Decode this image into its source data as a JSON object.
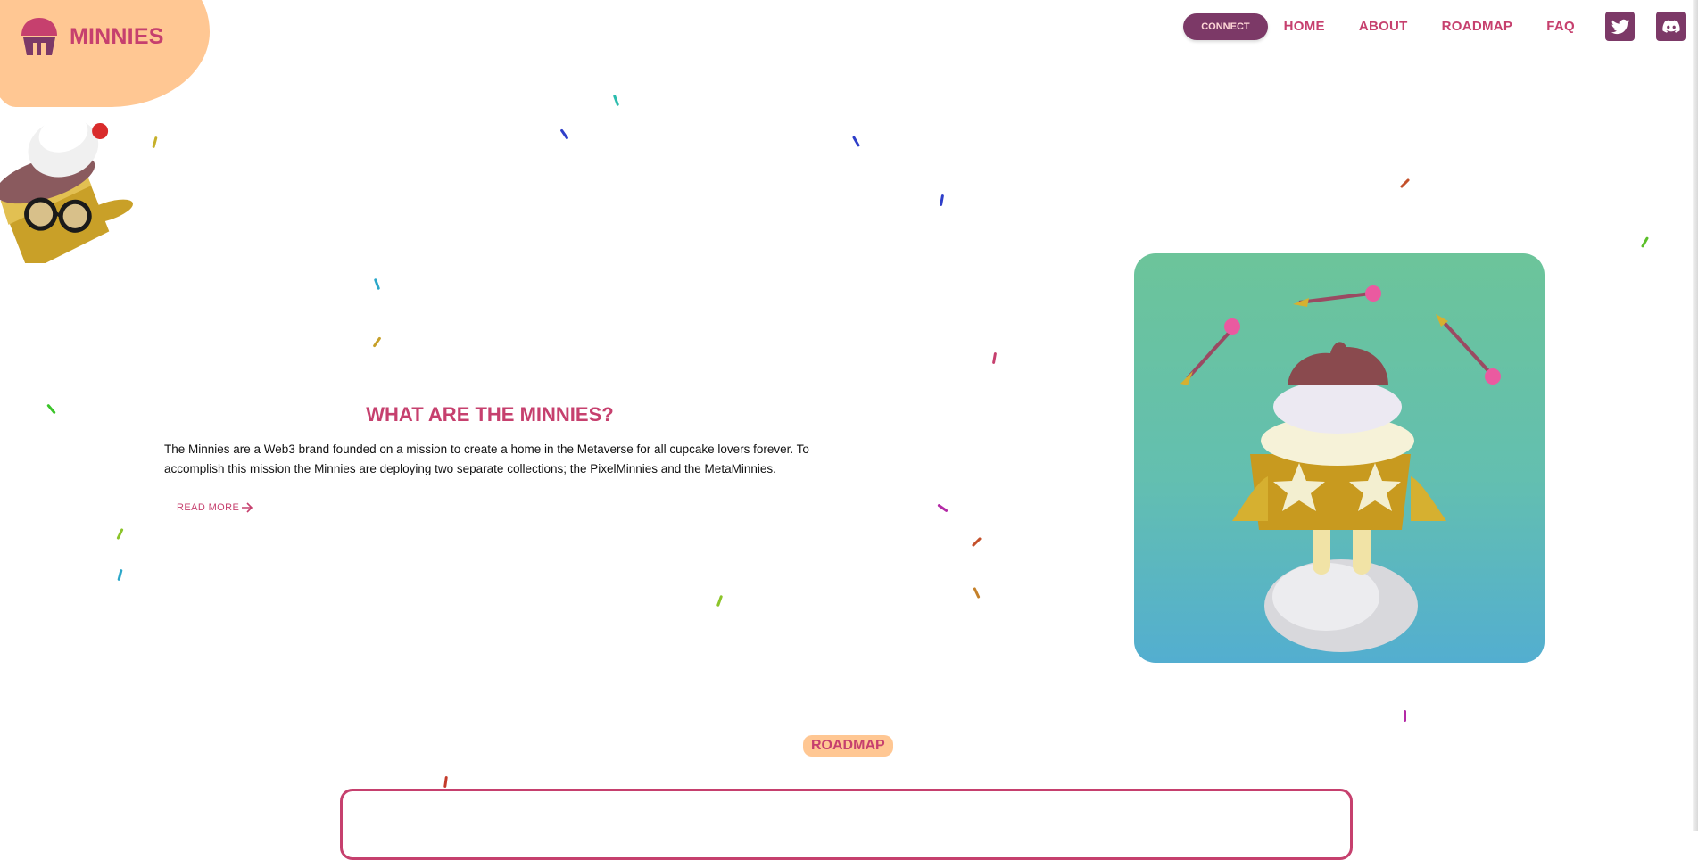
{
  "brand": {
    "name": "MINNIES",
    "logo_icon": "cupcake-icon"
  },
  "nav": {
    "connect_label": "CONNECT",
    "links": [
      "HOME",
      "ABOUT",
      "ROADMAP",
      "FAQ"
    ],
    "social": [
      "twitter-icon",
      "discord-icon"
    ]
  },
  "intro": {
    "title": "WHAT ARE THE MINNIES?",
    "text": "The Minnies are a Web3 brand founded on a mission to create a home in the Metaverse for all cupcake lovers forever. To accomplish this mission the Minnies are deploying two separate collections; the PixelMinnies and the MetaMinnies.",
    "read_more": "READ MORE"
  },
  "roadmap": {
    "label": "ROADMAP"
  },
  "colors": {
    "primary": "#c6406e",
    "dark": "#7c3967",
    "peach": "#ffc793",
    "background": "#ffffff"
  }
}
